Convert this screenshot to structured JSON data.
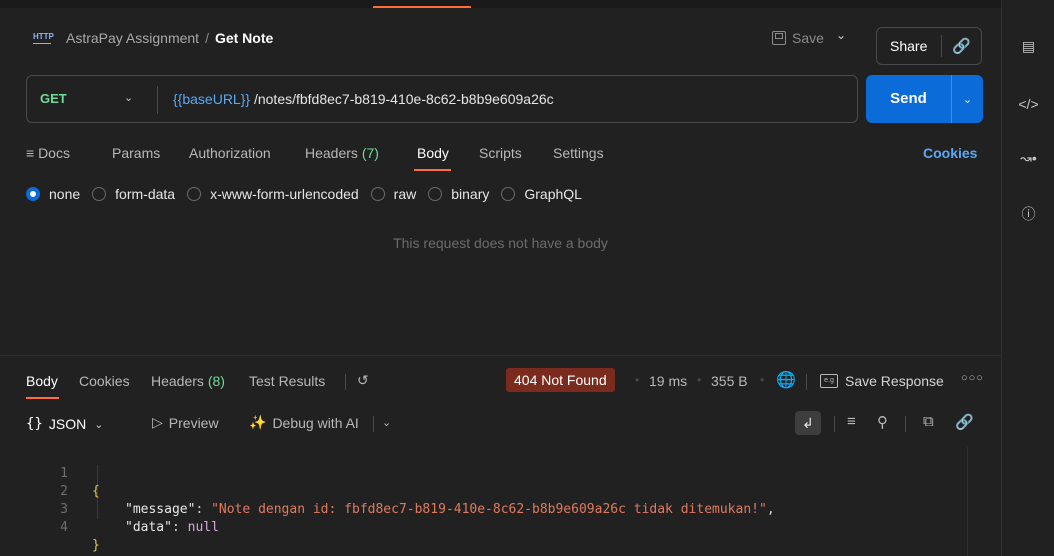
{
  "header": {
    "collection": "AstraPay Assignment",
    "separator": "/",
    "request_name": "Get Note",
    "http_badge": "HTTP",
    "save_label": "Save",
    "share_label": "Share"
  },
  "request": {
    "method": "GET",
    "url_variable": "{{baseURL}}",
    "url_path": " /notes/fbfd8ec7-b819-410e-8c62-b8b9e609a26c",
    "send_label": "Send"
  },
  "request_tabs": {
    "docs": "Docs",
    "params": "Params",
    "authorization": "Authorization",
    "headers": "Headers",
    "headers_count": "(7)",
    "body": "Body",
    "scripts": "Scripts",
    "settings": "Settings",
    "cookies": "Cookies"
  },
  "body_types": {
    "none": "none",
    "form_data": "form-data",
    "urlencoded": "x-www-form-urlencoded",
    "raw": "raw",
    "binary": "binary",
    "graphql": "GraphQL",
    "selected": "none"
  },
  "no_body_text": "This request does not have a body",
  "response": {
    "tabs": {
      "body": "Body",
      "cookies": "Cookies",
      "headers": "Headers",
      "headers_count": "(8)",
      "test_results": "Test Results"
    },
    "status": "404 Not Found",
    "status_color": "#7a2b1d",
    "time": "19 ms",
    "size": "355 B",
    "save_response": "Save Response",
    "format": "JSON",
    "preview": "Preview",
    "debug_ai": "Debug with AI"
  },
  "code_lines": [
    {
      "n": "1",
      "text": "{"
    },
    {
      "n": "2",
      "key": "\"message\"",
      "value": "\"Note dengan id: fbfd8ec7-b819-410e-8c62-b8b9e609a26c tidak ditemukan!\"",
      "tail": ","
    },
    {
      "n": "3",
      "key": "\"data\"",
      "value": "null"
    },
    {
      "n": "4",
      "text": "}"
    }
  ],
  "colors": {
    "accent": "#ff6c37",
    "send_blue": "#0b6bd8",
    "get_green": "#6bdd9a",
    "variable_blue": "#5aa9f5"
  }
}
